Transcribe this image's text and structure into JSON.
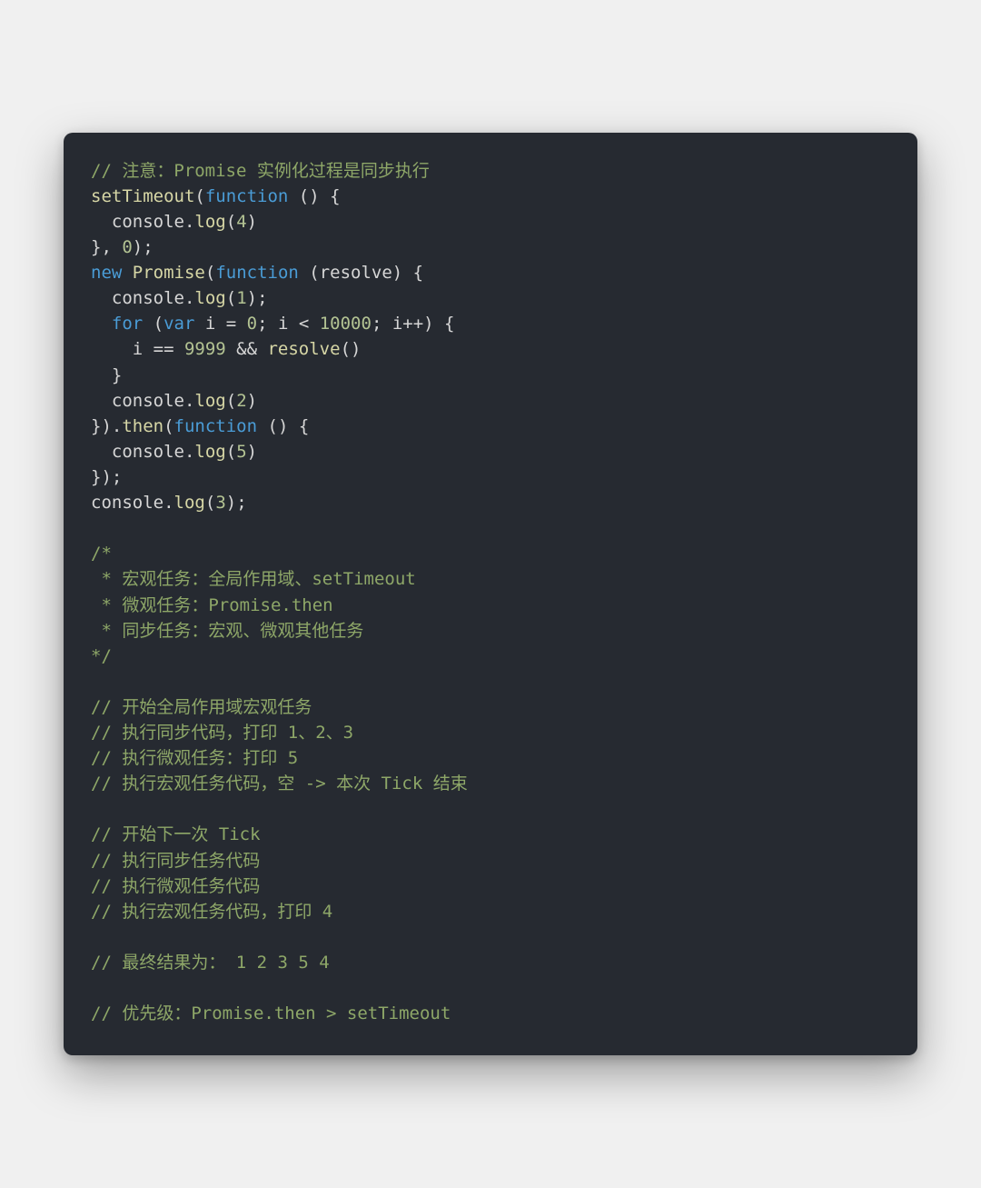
{
  "colors": {
    "background": "#f0f0f0",
    "card_bg": "#262a31",
    "comment": "#8ea768",
    "keyword": "#4a9cd6",
    "function": "#d7d7a6",
    "identifier": "#d6d6d6",
    "number": "#b3c393"
  },
  "code": {
    "line1_comment": "// 注意：Promise 实例化过程是同步执行",
    "line2_setTimeout": "setTimeout",
    "line2_punc1": "(",
    "line2_function": "function",
    "line2_punc2": " () {",
    "line3_console": "  console",
    "line3_dot": ".",
    "line3_log": "log",
    "line3_open": "(",
    "line3_num": "4",
    "line3_close": ")",
    "line4_close": "}, ",
    "line4_num": "0",
    "line4_end": ");",
    "line5_new": "new",
    "line5_sp": " ",
    "line5_Promise": "Promise",
    "line5_open": "(",
    "line5_function": "function",
    "line5_rest": " (resolve) {",
    "line6_console": "  console",
    "line6_dot": ".",
    "line6_log": "log",
    "line6_open": "(",
    "line6_num": "1",
    "line6_close": ");",
    "line7_for": "  for",
    "line7_open": " (",
    "line7_var": "var",
    "line7_i": " i ",
    "line7_eq": "= ",
    "line7_zero": "0",
    "line7_semi1": "; i < ",
    "line7_10000": "10000",
    "line7_semi2": "; i++) {",
    "line8_body": "    i == ",
    "line8_9999": "9999",
    "line8_and": " && ",
    "line8_resolve": "resolve",
    "line8_call": "()",
    "line9_close": "  }",
    "line10_console": "  console",
    "line10_dot": ".",
    "line10_log": "log",
    "line10_open": "(",
    "line10_num": "2",
    "line10_close": ")",
    "line11_close": "}).",
    "line11_then": "then",
    "line11_open": "(",
    "line11_function": "function",
    "line11_rest": " () {",
    "line12_console": "  console",
    "line12_dot": ".",
    "line12_log": "log",
    "line12_open": "(",
    "line12_num": "5",
    "line12_close": ")",
    "line13_close": "});",
    "line14_console": "console",
    "line14_dot": ".",
    "line14_log": "log",
    "line14_open": "(",
    "line14_num": "3",
    "line14_close": ");",
    "block_open": "/*",
    "block_l1": " * 宏观任务：全局作用域、setTimeout",
    "block_l2": " * 微观任务：Promise.then",
    "block_l3": " * 同步任务：宏观、微观其他任务",
    "block_close": "*/",
    "c1": "// 开始全局作用域宏观任务",
    "c2": "// 执行同步代码，打印 1、2、3",
    "c3": "// 执行微观任务：打印 5",
    "c4": "// 执行宏观任务代码，空 -> 本次 Tick 结束",
    "c5": "// 开始下一次 Tick",
    "c6": "// 执行同步任务代码",
    "c7": "// 执行微观任务代码",
    "c8": "// 执行宏观任务代码，打印 4",
    "c9": "// 最终结果为： 1 2 3 5 4",
    "c10": "// 优先级：Promise.then > setTimeout"
  }
}
